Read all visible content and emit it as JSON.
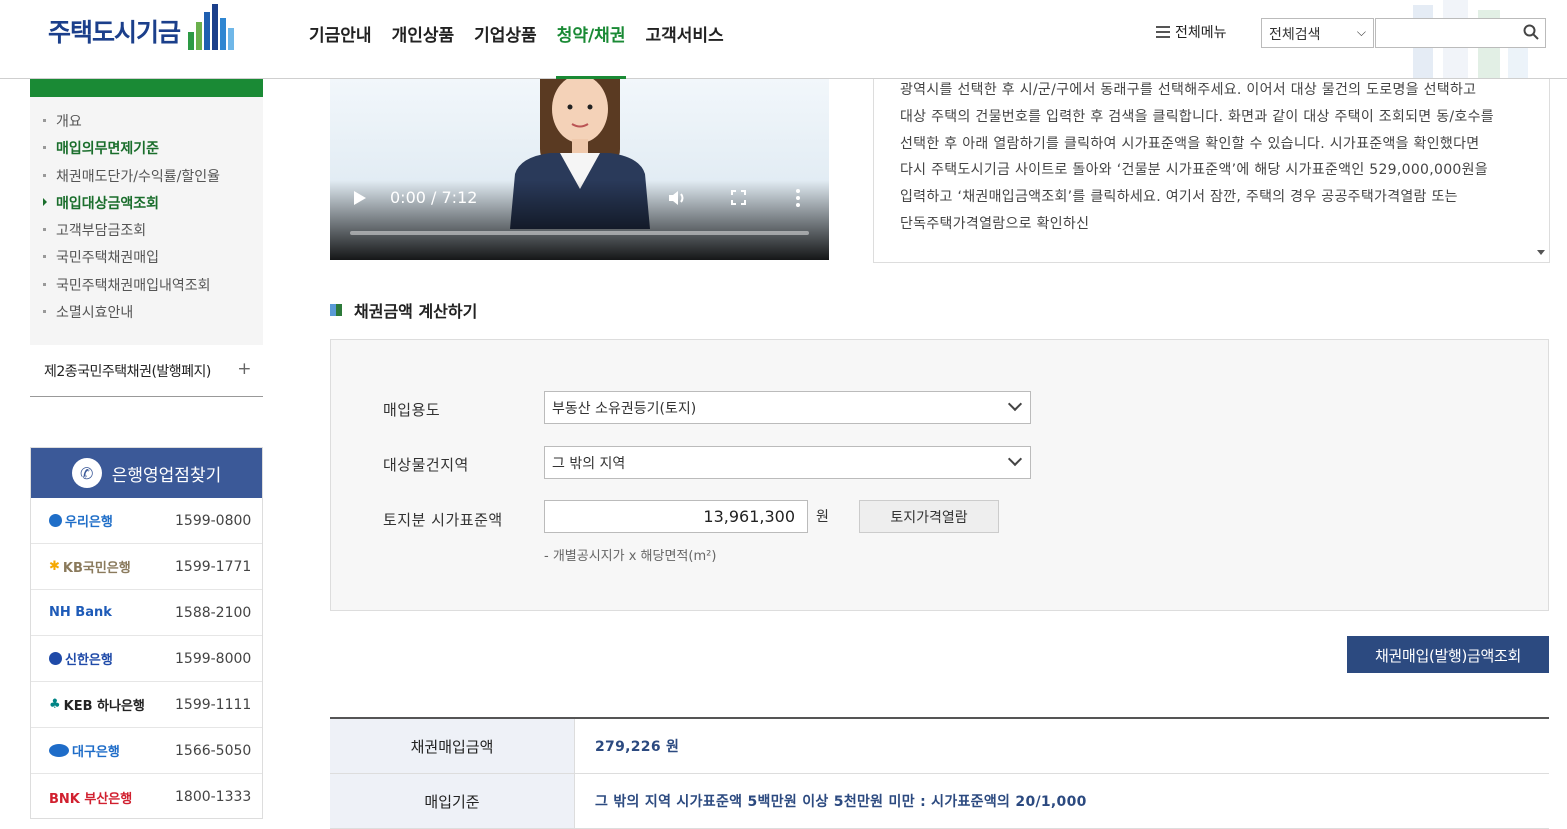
{
  "header": {
    "logo_text": "주택도시기금",
    "nav": [
      "기금안내",
      "개인상품",
      "기업상품",
      "청약/채권",
      "고객서비스"
    ],
    "nav_active_index": 3,
    "all_menu_label": "전체메뉴",
    "search_scope": "전체검색",
    "search_placeholder": ""
  },
  "sidebar": {
    "items": [
      {
        "label": "개요",
        "state": "normal"
      },
      {
        "label": "매입의무면제기준",
        "state": "bold"
      },
      {
        "label": "채권매도단가/수익률/할인율",
        "state": "normal"
      },
      {
        "label": "매입대상금액조회",
        "state": "current"
      },
      {
        "label": "고객부담금조회",
        "state": "normal"
      },
      {
        "label": "국민주택채권매입",
        "state": "normal"
      },
      {
        "label": "국민주택채권매입내역조회",
        "state": "normal"
      },
      {
        "label": "소멸시효안내",
        "state": "normal"
      }
    ],
    "section2_label": "제2종국민주택채권(발행폐지)",
    "section2_toggle": "+"
  },
  "banks": {
    "title": "은행영업점찾기",
    "list": [
      {
        "name": "우리은행",
        "tel": "1599-0800",
        "color": "#1f6ec8"
      },
      {
        "name": "KB국민은행",
        "tel": "1599-1771",
        "color": "#8a7a5c"
      },
      {
        "name": "NH Bank",
        "tel": "1588-2100",
        "color": "#1e5bb8"
      },
      {
        "name": "신한은행",
        "tel": "1599-8000",
        "color": "#1f4aa8"
      },
      {
        "name": "KEB 하나은행",
        "tel": "1599-1111",
        "color": "#008485"
      },
      {
        "name": "대구은행",
        "tel": "1566-5050",
        "color": "#1e6cc8"
      },
      {
        "name": "BNK 부산은행",
        "tel": "1800-1333",
        "color": "#d1202f"
      }
    ]
  },
  "video": {
    "time": "0:00 / 7:12",
    "progress": 0
  },
  "script": {
    "text": "광역시를 선택한 후 시/군/구에서 동래구를 선택해주세요. 이어서 대상 물건의 도로명을 선택하고 대상 주택의 건물번호를 입력한 후 검색을 클릭합니다. 화면과 같이 대상 주택이 조회되면 동/호수를 선택한 후 아래 열람하기를 클릭하여 시가표준액을 확인할 수 있습니다. 시가표준액을 확인했다면 다시 주택도시기금 사이트로 돌아와 ‘건물분 시가표준액’에 해당 시가표준액인 529,000,000원을 입력하고 ‘채권매입금액조회’를 클릭하세요. 여기서 잠깐, 주택의 경우 공공주택가격열람 또는 단독주택가격열람으로 확인하신"
  },
  "calc": {
    "title": "채권금액 계산하기",
    "purpose_label": "매입용도",
    "purpose_value": "부동산 소유권등기(토지)",
    "region_label": "대상물건지역",
    "region_value": "그 밖의 지역",
    "land_label": "토지분 시가표준액",
    "land_value": "13,961,300",
    "unit": "원",
    "land_button": "토지가격열람",
    "hint": "- 개별공시지가 x 해당면적(m²)",
    "query_button": "채권매입(발행)금액조회"
  },
  "result": {
    "rows": [
      {
        "label": "채권매입금액",
        "value": "279,226 원"
      },
      {
        "label": "매입기준",
        "value": "그 밖의 지역 시가표준액 5백만원 이상 5천만원 미만 : 시가표준액의 20/1,000"
      }
    ]
  },
  "colors": {
    "brand_green": "#1a8a35",
    "navy": "#2c4a80",
    "bank_header": "#3b5998"
  }
}
